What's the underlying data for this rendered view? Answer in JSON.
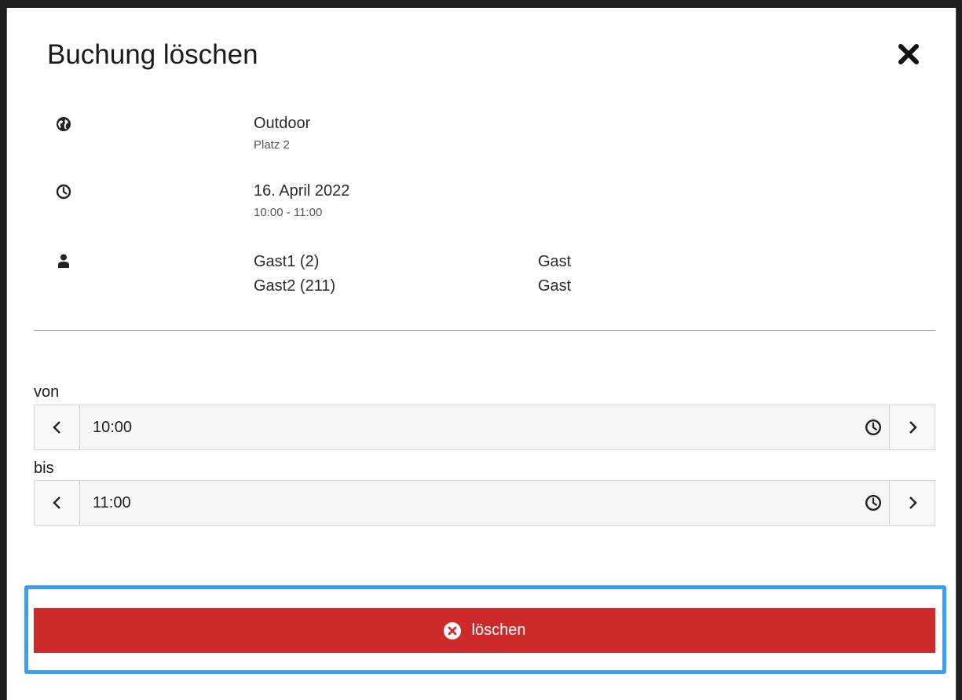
{
  "dialog": {
    "title": "Buchung löschen"
  },
  "location": {
    "icon": "globe-icon",
    "name": "Outdoor",
    "court": "Platz 2"
  },
  "time": {
    "icon": "clock-icon",
    "date": "16. April 2022",
    "range": "10:00 - 11:00"
  },
  "players": {
    "icon": "person-icon",
    "list": [
      {
        "name": "Gast1 (2)",
        "type": "Gast"
      },
      {
        "name": "Gast2 (211)",
        "type": "Gast"
      }
    ]
  },
  "from_field": {
    "label": "von",
    "value": "10:00"
  },
  "to_field": {
    "label": "bis",
    "value": "11:00"
  },
  "delete_button": {
    "label": "löschen",
    "icon": "circle-x-icon",
    "color": "#cd2a2a"
  },
  "colors": {
    "highlight": "#3b9ef0"
  }
}
